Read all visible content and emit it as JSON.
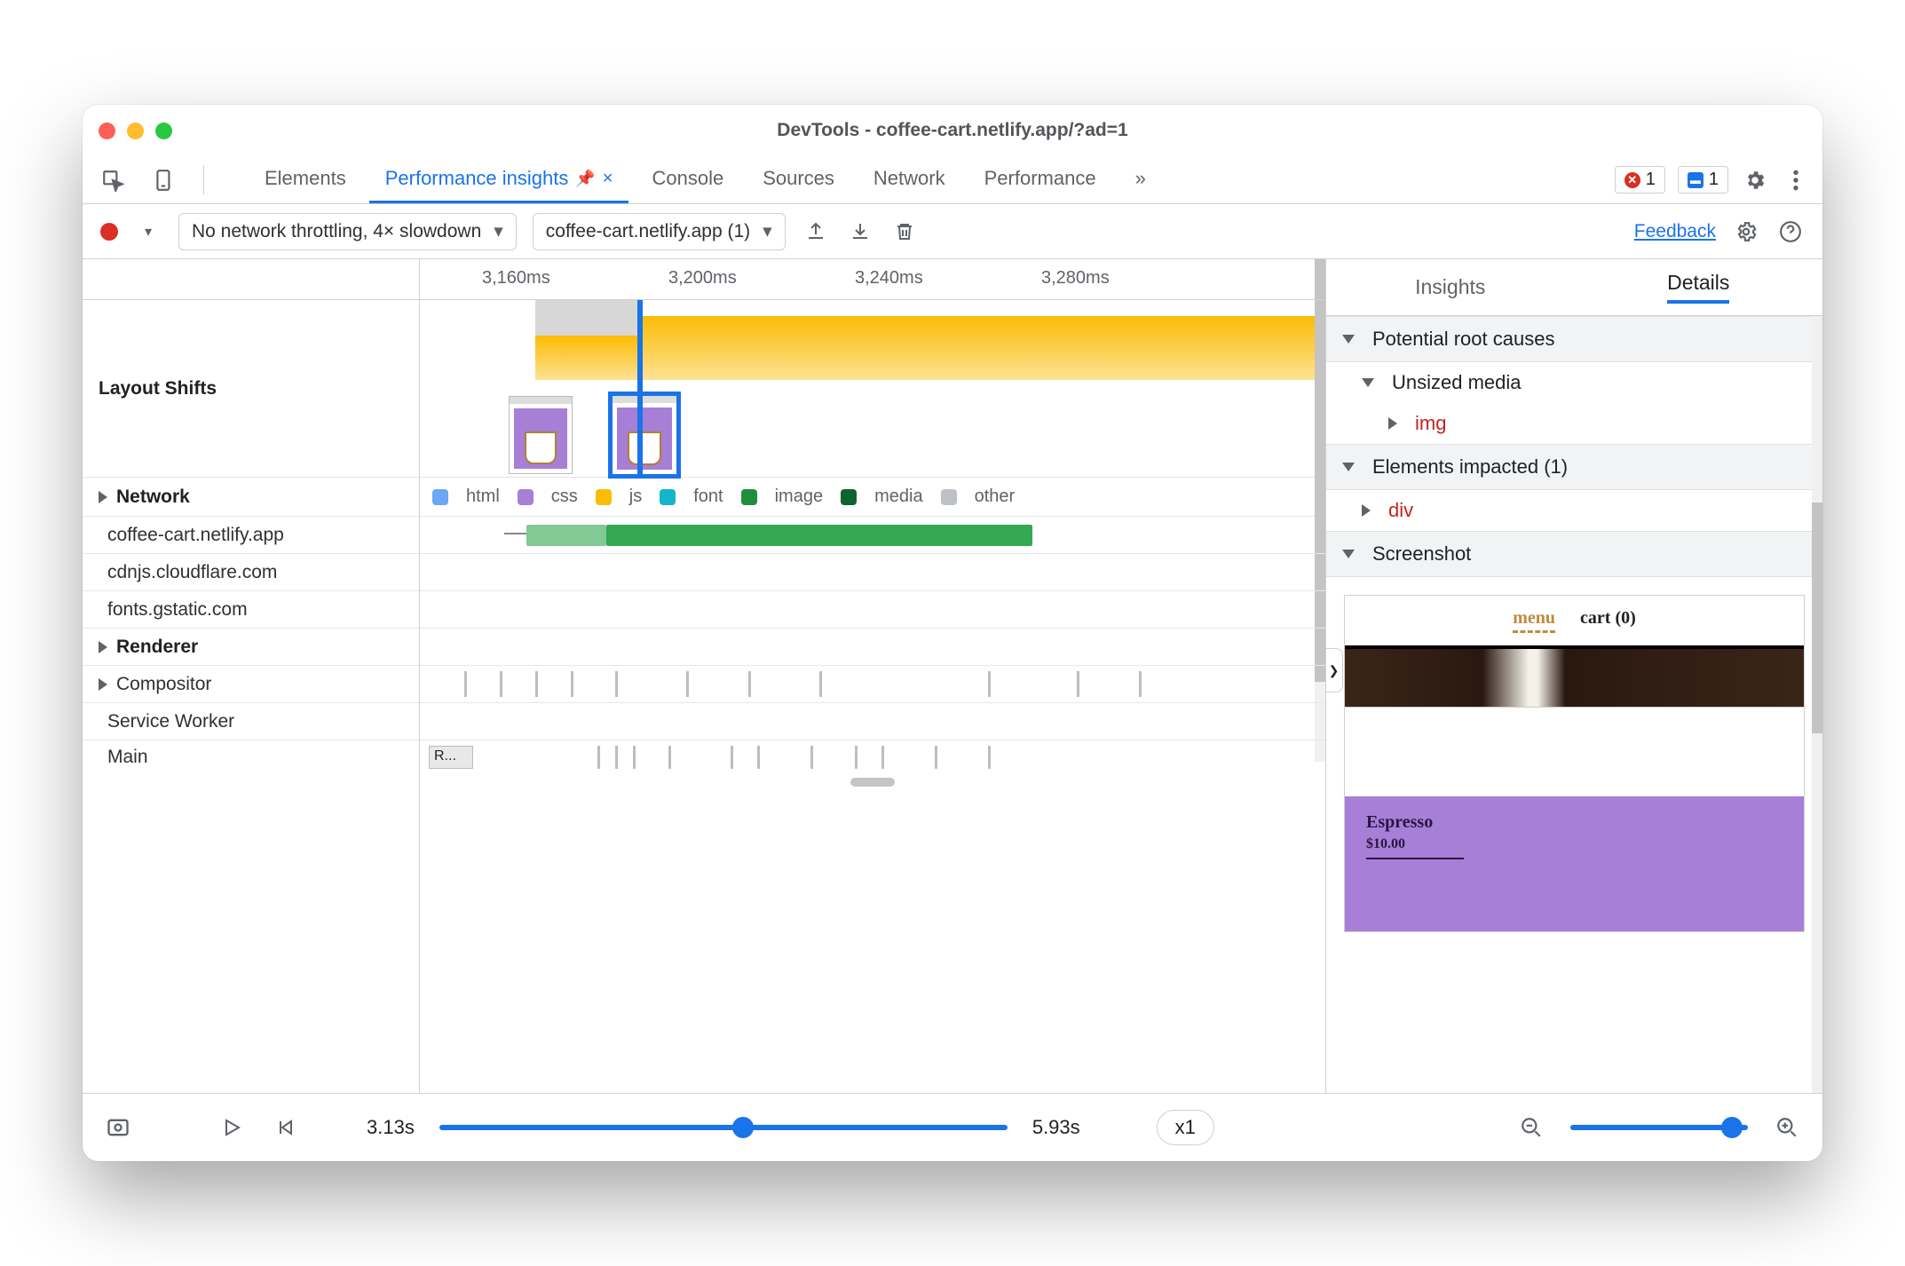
{
  "window": {
    "title": "DevTools - coffee-cart.netlify.app/?ad=1"
  },
  "tabs": {
    "items": [
      "Elements",
      "Performance insights",
      "Console",
      "Sources",
      "Network",
      "Performance"
    ],
    "active_index": 1,
    "pinned_index": 1
  },
  "indicators": {
    "error_count": "1",
    "message_count": "1"
  },
  "toolbar": {
    "throttle_label": "No network throttling, 4× slowdown",
    "target_label": "coffee-cart.netlify.app (1)",
    "feedback": "Feedback"
  },
  "ruler_ticks": [
    "3,160ms",
    "3,200ms",
    "3,240ms",
    "3,280ms"
  ],
  "lanes": {
    "layout_shifts": "Layout Shifts",
    "network": "Network",
    "renderer": "Renderer",
    "compositor": "Compositor",
    "service_worker": "Service Worker",
    "main": "Main",
    "main_run_label": "R...",
    "network_rows": [
      "coffee-cart.netlify.app",
      "cdnjs.cloudflare.com",
      "fonts.gstatic.com"
    ]
  },
  "legend": {
    "html": "html",
    "css": "css",
    "js": "js",
    "font": "font",
    "image": "image",
    "media": "media",
    "other": "other"
  },
  "details": {
    "tabs": {
      "insights": "Insights",
      "details": "Details",
      "active": "details"
    },
    "root_causes_h": "Potential root causes",
    "unsized_media": "Unsized media",
    "img_tag": "img",
    "elements_impacted_h": "Elements impacted (1)",
    "div_tag": "div",
    "screenshot_h": "Screenshot",
    "preview": {
      "menu": "menu",
      "cart": "cart (0)",
      "product": "Espresso",
      "price": "$10.00"
    }
  },
  "footer": {
    "t_start": "3.13s",
    "t_end": "5.93s",
    "speed": "x1"
  }
}
